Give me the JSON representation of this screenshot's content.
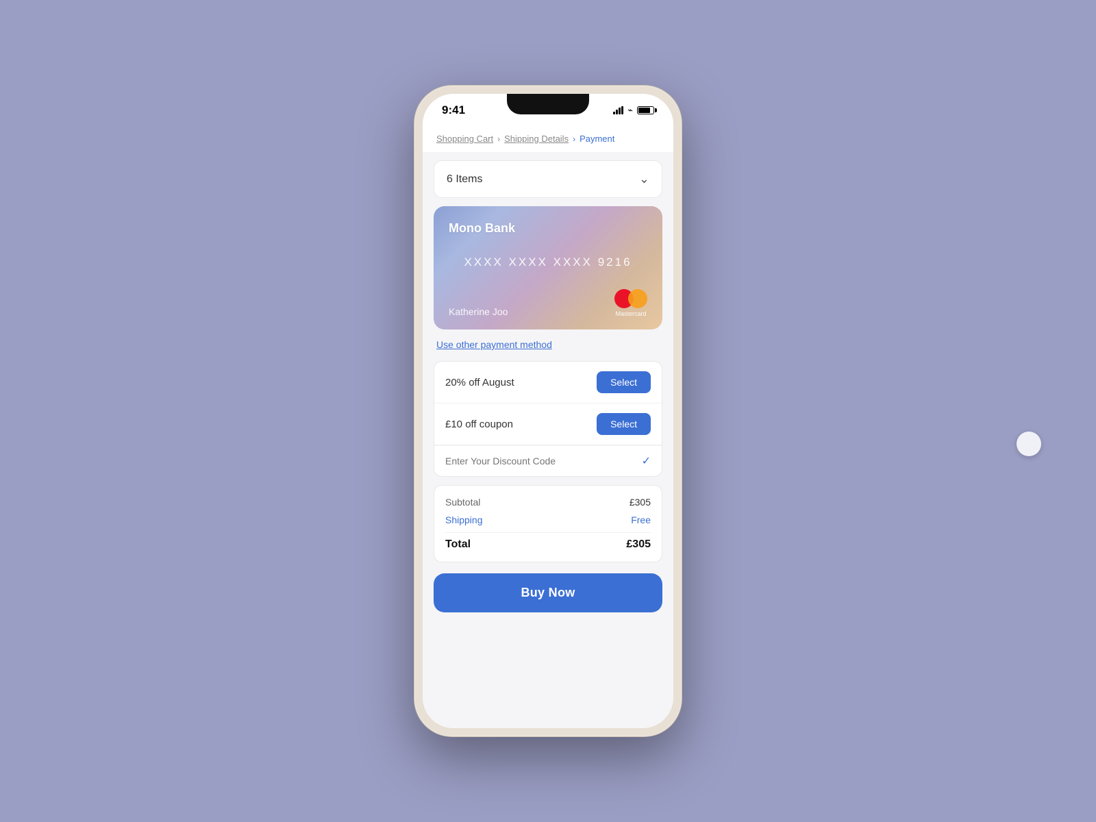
{
  "status_bar": {
    "time": "9:41",
    "signal_label": "signal",
    "wifi_label": "wifi",
    "battery_label": "battery"
  },
  "breadcrumb": {
    "step1": "Shopping Cart",
    "step2": "Shipping Details",
    "step3": "Payment"
  },
  "items_dropdown": {
    "label": "6 Items"
  },
  "credit_card": {
    "bank_name": "Mono Bank",
    "card_number": "XXXX  XXXX  XXXX  9216",
    "holder_name": "Katherine Joo",
    "brand": "Mastercard"
  },
  "payment_method_link": "Use other payment method",
  "coupons": [
    {
      "label": "20% off August",
      "button": "Select"
    },
    {
      "label": "£10 off coupon",
      "button": "Select"
    }
  ],
  "discount_code": {
    "placeholder": "Enter Your Discount Code"
  },
  "order_summary": {
    "subtotal_label": "Subtotal",
    "subtotal_value": "£305",
    "shipping_label": "Shipping",
    "shipping_value": "Free",
    "total_label": "Total",
    "total_value": "£305"
  },
  "buy_now_button": "Buy Now"
}
